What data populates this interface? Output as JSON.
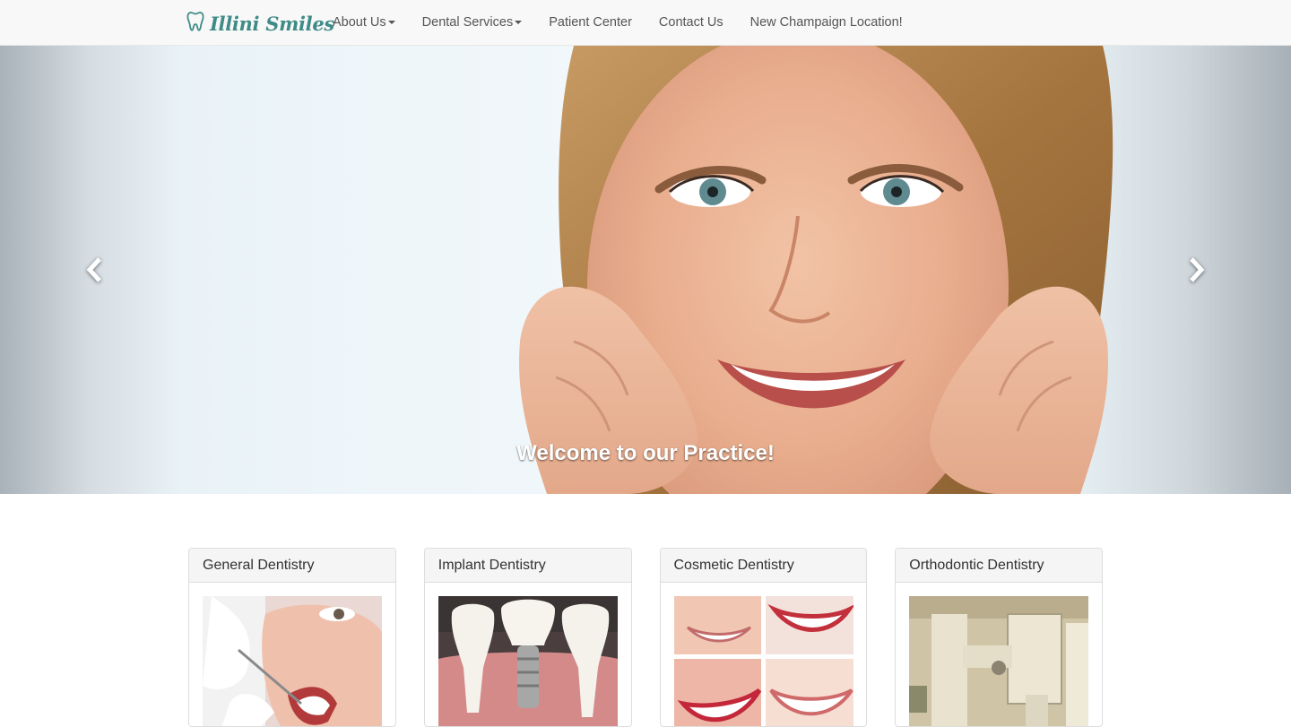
{
  "brand": {
    "name": "Illini Smiles",
    "icon": "tooth-icon",
    "color": "#3e8b87"
  },
  "nav": {
    "items": [
      {
        "label": "About Us",
        "dropdown": true
      },
      {
        "label": "Dental Services",
        "dropdown": true
      },
      {
        "label": "Patient Center",
        "dropdown": false
      },
      {
        "label": "Contact Us",
        "dropdown": false
      },
      {
        "label": "New Champaign Location!",
        "dropdown": false
      }
    ]
  },
  "hero": {
    "caption": "Welcome to our Practice!",
    "prev_icon": "chevron-left-icon",
    "next_icon": "chevron-right-icon"
  },
  "services": [
    {
      "title": "General Dentistry",
      "image": "dentist-examining-patient-photo"
    },
    {
      "title": "Implant Dentistry",
      "image": "dental-implant-model-photo"
    },
    {
      "title": "Cosmetic Dentistry",
      "image": "smile-collage-photo"
    },
    {
      "title": "Orthodontic Dentistry",
      "image": "dental-xray-machine-photo"
    }
  ]
}
